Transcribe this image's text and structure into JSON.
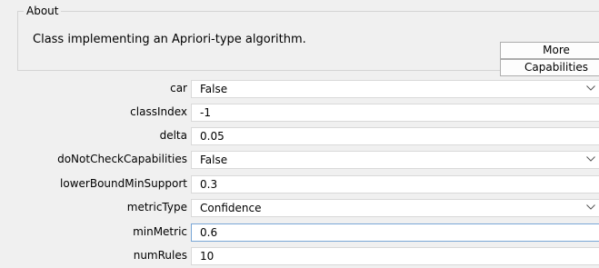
{
  "about": {
    "legend": "About",
    "description": "Class implementing an Apriori-type algorithm.",
    "more_label": "More",
    "capabilities_label": "Capabilities"
  },
  "properties": [
    {
      "label": "car",
      "value": "False",
      "type": "dropdown"
    },
    {
      "label": "classIndex",
      "value": "-1",
      "type": "text"
    },
    {
      "label": "delta",
      "value": "0.05",
      "type": "text"
    },
    {
      "label": "doNotCheckCapabilities",
      "value": "False",
      "type": "dropdown"
    },
    {
      "label": "lowerBoundMinSupport",
      "value": "0.3",
      "type": "text"
    },
    {
      "label": "metricType",
      "value": "Confidence",
      "type": "dropdown"
    },
    {
      "label": "minMetric",
      "value": "0.6",
      "type": "text",
      "focused": true
    },
    {
      "label": "numRules",
      "value": "10",
      "type": "text"
    }
  ],
  "icons": {
    "dropdown": "chevron-down-icon"
  },
  "colors": {
    "window_bg": "#f0f0f0",
    "field_bg": "#ffffff",
    "focus_border": "#7aa7d6"
  }
}
